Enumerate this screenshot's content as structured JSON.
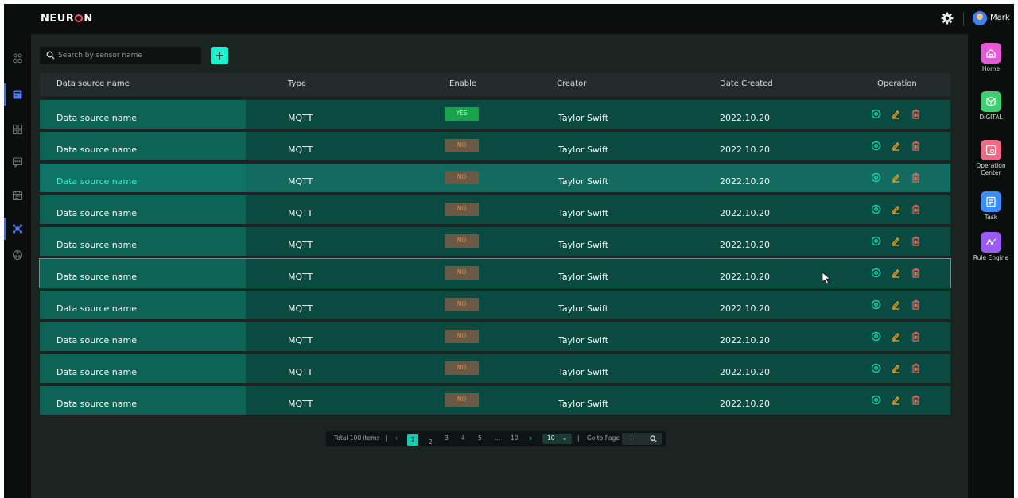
{
  "app": {
    "logo": "NEUR•N",
    "logo_pre": "NEUR",
    "logo_post": "N",
    "user": "Mark"
  },
  "left_nav": [
    {
      "icon": "users-icon",
      "active": false
    },
    {
      "icon": "document-icon",
      "active": true
    },
    {
      "icon": "grid-icon",
      "active": false
    },
    {
      "icon": "chat-icon",
      "active": false
    },
    {
      "icon": "calendar-icon",
      "active": false
    },
    {
      "icon": "molecule-icon",
      "active": true
    },
    {
      "icon": "network-icon",
      "active": false
    }
  ],
  "right_nav": [
    {
      "label": "Home",
      "icon": "home-icon",
      "color": "#e35bd6"
    },
    {
      "label": "DIGITAL",
      "icon": "cube-icon",
      "color": "#3fcf70"
    },
    {
      "label": "Operation Center",
      "icon": "settings-panel-icon",
      "color": "#ef6b85"
    },
    {
      "label": "Task",
      "icon": "task-icon",
      "color": "#3b8ef5"
    },
    {
      "label": "Rule Engine",
      "icon": "rule-icon",
      "color": "#9b5cf6"
    }
  ],
  "search": {
    "placeholder": "Search by sensor name"
  },
  "table": {
    "headers": [
      "Data source name",
      "Type",
      "Enable",
      "Creator",
      "Date Created",
      "Operation"
    ],
    "rows": [
      {
        "name": "Data source name",
        "type": "MQTT",
        "enable": "YES",
        "creator": "Taylor Swift",
        "date": "2022.10.20"
      },
      {
        "name": "Data source name",
        "type": "MQTT",
        "enable": "NO",
        "creator": "Taylor Swift",
        "date": "2022.10.20"
      },
      {
        "name": "Data source name",
        "type": "MQTT",
        "enable": "NO",
        "creator": "Taylor Swift",
        "date": "2022.10.20"
      },
      {
        "name": "Data source name",
        "type": "MQTT",
        "enable": "NO",
        "creator": "Taylor Swift",
        "date": "2022.10.20"
      },
      {
        "name": "Data source name",
        "type": "MQTT",
        "enable": "NO",
        "creator": "Taylor Swift",
        "date": "2022.10.20"
      },
      {
        "name": "Data source name",
        "type": "MQTT",
        "enable": "NO",
        "creator": "Taylor Swift",
        "date": "2022.10.20"
      },
      {
        "name": "Data source name",
        "type": "MQTT",
        "enable": "NO",
        "creator": "Taylor Swift",
        "date": "2022.10.20"
      },
      {
        "name": "Data source name",
        "type": "MQTT",
        "enable": "NO",
        "creator": "Taylor Swift",
        "date": "2022.10.20"
      },
      {
        "name": "Data source name",
        "type": "MQTT",
        "enable": "NO",
        "creator": "Taylor Swift",
        "date": "2022.10.20"
      },
      {
        "name": "Data source name",
        "type": "MQTT",
        "enable": "NO",
        "creator": "Taylor Swift",
        "date": "2022.10.20"
      }
    ]
  },
  "pagination": {
    "total": "Total 100 items",
    "prev": "‹",
    "pages": [
      "1",
      "2",
      "3",
      "4",
      "5",
      "...",
      "10"
    ],
    "next": "›",
    "page_size": "10",
    "goto_label": "Go to Page",
    "goto_value": "|"
  },
  "colors": {
    "accent": "#1ff0d0",
    "yes": "#16a34a",
    "no": "#f08a3a",
    "row": "#0a4a40"
  }
}
